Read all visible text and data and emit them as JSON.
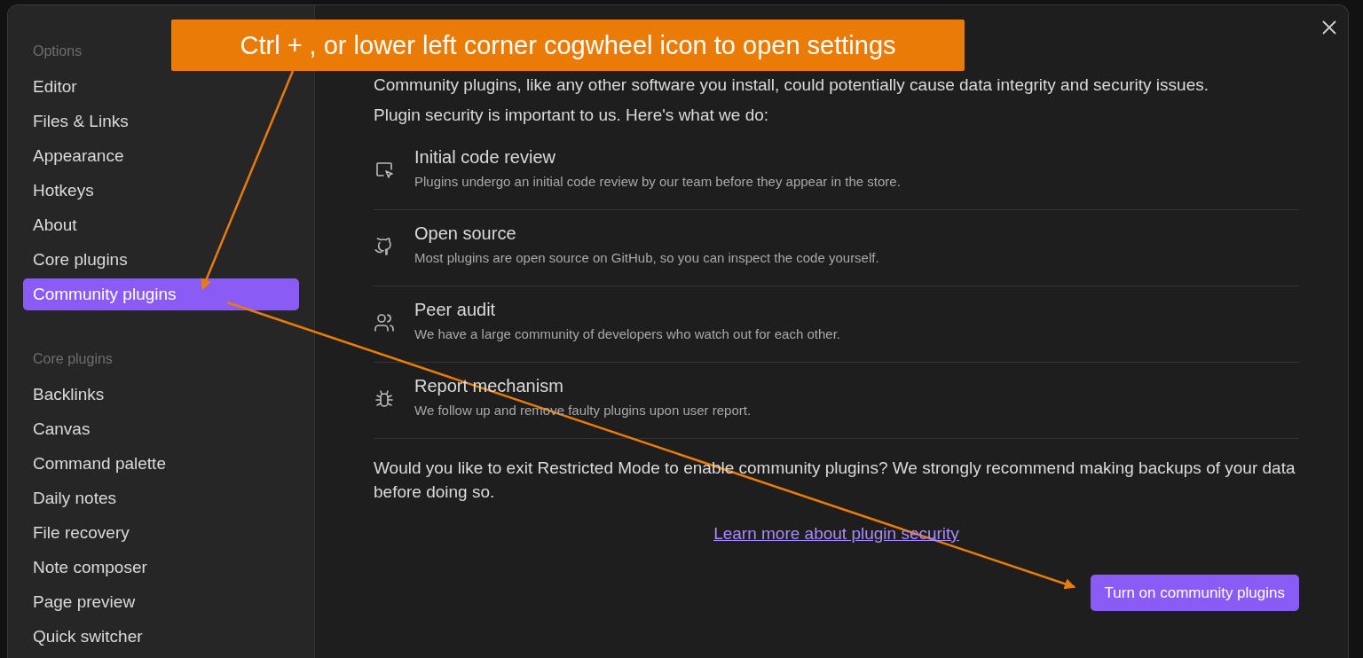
{
  "sidebar": {
    "sections": [
      {
        "heading": "Options",
        "items": [
          {
            "label": "Editor",
            "selected": false
          },
          {
            "label": "Files & Links",
            "selected": false
          },
          {
            "label": "Appearance",
            "selected": false
          },
          {
            "label": "Hotkeys",
            "selected": false
          },
          {
            "label": "About",
            "selected": false
          },
          {
            "label": "Core plugins",
            "selected": false
          },
          {
            "label": "Community plugins",
            "selected": true
          }
        ]
      },
      {
        "heading": "Core plugins",
        "items": [
          {
            "label": "Backlinks",
            "selected": false
          },
          {
            "label": "Canvas",
            "selected": false
          },
          {
            "label": "Command palette",
            "selected": false
          },
          {
            "label": "Daily notes",
            "selected": false
          },
          {
            "label": "File recovery",
            "selected": false
          },
          {
            "label": "Note composer",
            "selected": false
          },
          {
            "label": "Page preview",
            "selected": false
          },
          {
            "label": "Quick switcher",
            "selected": false
          }
        ]
      }
    ]
  },
  "content": {
    "intro": "Community plugins, like any other software you install, could potentially cause data integrity and security issues.",
    "security_heading": "Plugin security is important to us. Here's what we do:",
    "measures": [
      {
        "kind": "review",
        "title": "Initial code review",
        "description": "Plugins undergo an initial code review by our team before they appear in the store."
      },
      {
        "kind": "github",
        "title": "Open source",
        "description": "Most plugins are open source on GitHub, so you can inspect the code yourself."
      },
      {
        "kind": "people",
        "title": "Peer audit",
        "description": "We have a large community of developers who watch out for each other."
      },
      {
        "kind": "bug",
        "title": "Report mechanism",
        "description": "We follow up and remove faulty plugins upon user report."
      }
    ],
    "question": "Would you like to exit Restricted Mode to enable community plugins? We strongly recommend making backups of your data before doing so.",
    "link": "Learn more about plugin security",
    "button": "Turn on community plugins"
  },
  "annotation": {
    "text": "Ctrl + , or lower left corner cogwheel icon to open settings"
  }
}
